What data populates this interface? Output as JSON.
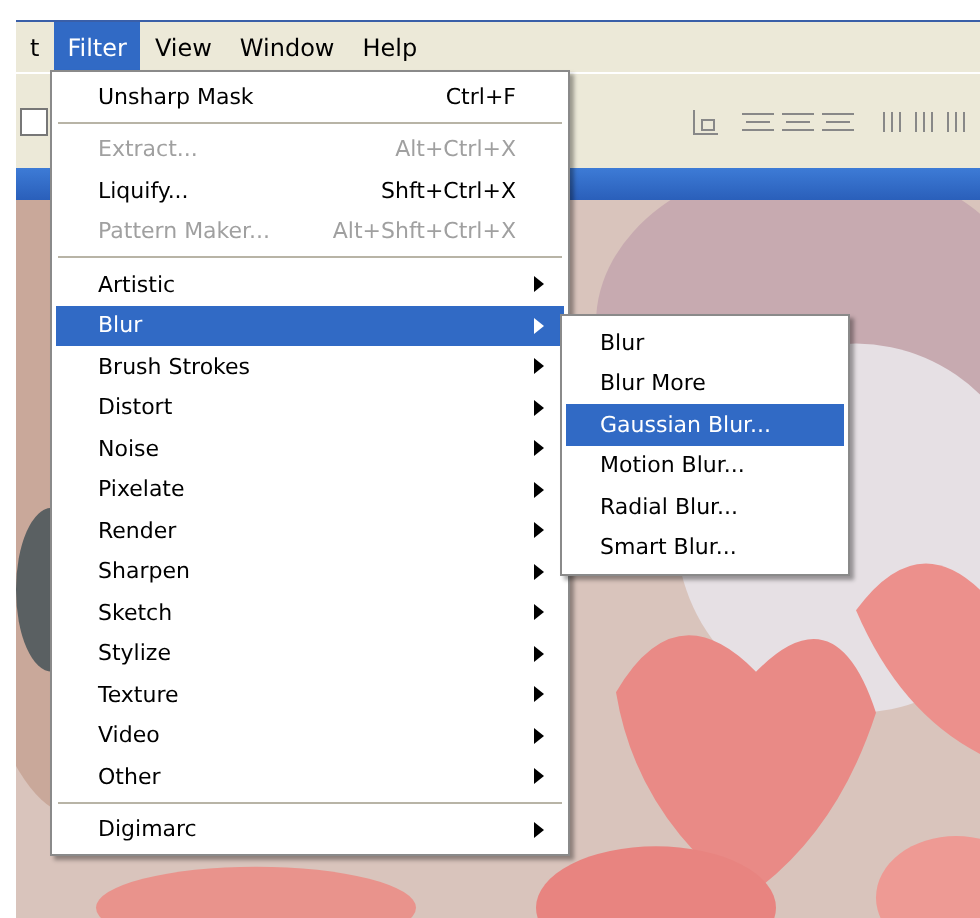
{
  "menubar": [
    {
      "label": "t",
      "selected": false
    },
    {
      "label": "Filter",
      "selected": true
    },
    {
      "label": "View",
      "selected": false
    },
    {
      "label": "Window",
      "selected": false
    },
    {
      "label": "Help",
      "selected": false
    }
  ],
  "toolbar": {
    "checkbox": {
      "checked": false
    }
  },
  "filter_menu": {
    "items": [
      {
        "kind": "item",
        "label": "Unsharp Mask",
        "shortcut": "Ctrl+F",
        "disabled": false,
        "selected": false
      },
      {
        "kind": "separator"
      },
      {
        "kind": "item",
        "label": "Extract...",
        "shortcut": "Alt+Ctrl+X",
        "disabled": true,
        "selected": false
      },
      {
        "kind": "item",
        "label": "Liquify...",
        "shortcut": "Shft+Ctrl+X",
        "disabled": false,
        "selected": false
      },
      {
        "kind": "item",
        "label": "Pattern Maker...",
        "shortcut": "Alt+Shft+Ctrl+X",
        "disabled": true,
        "selected": false
      },
      {
        "kind": "separator"
      },
      {
        "kind": "submenu",
        "label": "Artistic",
        "selected": false
      },
      {
        "kind": "submenu",
        "label": "Blur",
        "selected": true
      },
      {
        "kind": "submenu",
        "label": "Brush Strokes",
        "selected": false
      },
      {
        "kind": "submenu",
        "label": "Distort",
        "selected": false
      },
      {
        "kind": "submenu",
        "label": "Noise",
        "selected": false
      },
      {
        "kind": "submenu",
        "label": "Pixelate",
        "selected": false
      },
      {
        "kind": "submenu",
        "label": "Render",
        "selected": false
      },
      {
        "kind": "submenu",
        "label": "Sharpen",
        "selected": false
      },
      {
        "kind": "submenu",
        "label": "Sketch",
        "selected": false
      },
      {
        "kind": "submenu",
        "label": "Stylize",
        "selected": false
      },
      {
        "kind": "submenu",
        "label": "Texture",
        "selected": false
      },
      {
        "kind": "submenu",
        "label": "Video",
        "selected": false
      },
      {
        "kind": "submenu",
        "label": "Other",
        "selected": false
      },
      {
        "kind": "separator"
      },
      {
        "kind": "submenu",
        "label": "Digimarc",
        "selected": false
      }
    ]
  },
  "blur_submenu": {
    "items": [
      {
        "label": "Blur",
        "selected": false
      },
      {
        "label": "Blur More",
        "selected": false
      },
      {
        "label": "Gaussian Blur...",
        "selected": true
      },
      {
        "label": "Motion Blur...",
        "selected": false
      },
      {
        "label": "Radial Blur...",
        "selected": false
      },
      {
        "label": "Smart Blur...",
        "selected": false
      }
    ]
  }
}
